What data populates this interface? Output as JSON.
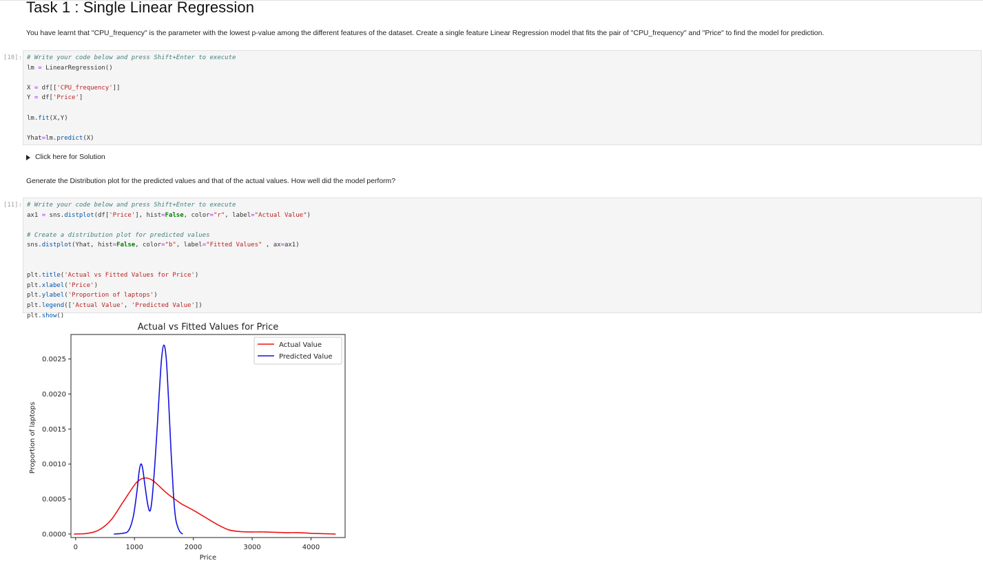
{
  "heading": "Task 1 : Single Linear Regression",
  "intro_text": "You have learnt that \"CPU_frequency\" is the parameter with the lowest p-value among the different features of the dataset. Create a single feature Linear Regression model that fits the pair of \"CPU_frequency\" and \"Price\" to find the model for prediction.",
  "cell1": {
    "prompt": "[10]:",
    "lines": [
      [
        [
          "cm",
          "# Write your code below and press Shift+Enter to execute"
        ]
      ],
      [
        [
          "",
          "lm "
        ],
        [
          "op",
          "="
        ],
        [
          "",
          " LinearRegression()"
        ]
      ],
      [],
      [
        [
          "",
          "X "
        ],
        [
          "op",
          "="
        ],
        [
          "",
          " df[["
        ],
        [
          "st",
          "'CPU_frequency'"
        ],
        [
          "",
          "]]"
        ]
      ],
      [
        [
          "",
          "Y "
        ],
        [
          "op",
          "="
        ],
        [
          "",
          " df["
        ],
        [
          "st",
          "'Price'"
        ],
        [
          "",
          "]"
        ]
      ],
      [],
      [
        [
          "",
          "lm."
        ],
        [
          "fn",
          "fit"
        ],
        [
          "",
          "(X,Y)"
        ]
      ],
      [],
      [
        [
          "",
          "Yhat"
        ],
        [
          "op",
          "="
        ],
        [
          "",
          "lm."
        ],
        [
          "fn",
          "predict"
        ],
        [
          "",
          "(X)"
        ]
      ]
    ]
  },
  "solution_toggle": "Click here for Solution",
  "question_text": "Generate the Distribution plot for the predicted values and that of the actual values. How well did the model perform?",
  "cell2": {
    "prompt": "[11]:",
    "lines": [
      [
        [
          "cm",
          "# Write your code below and press Shift+Enter to execute"
        ]
      ],
      [
        [
          "",
          "ax1 "
        ],
        [
          "op",
          "="
        ],
        [
          "",
          " sns."
        ],
        [
          "fn",
          "distplot"
        ],
        [
          "",
          "(df["
        ],
        [
          "st",
          "'Price'"
        ],
        [
          "",
          "], hist"
        ],
        [
          "op",
          "="
        ],
        [
          "kw",
          "False"
        ],
        [
          "",
          ", color"
        ],
        [
          "op",
          "="
        ],
        [
          "st",
          "\"r\""
        ],
        [
          "",
          ", label"
        ],
        [
          "op",
          "="
        ],
        [
          "st",
          "\"Actual Value\""
        ],
        [
          "",
          ")"
        ]
      ],
      [],
      [
        [
          "cm",
          "# Create a distribution plot for predicted values"
        ]
      ],
      [
        [
          "",
          "sns."
        ],
        [
          "fn",
          "distplot"
        ],
        [
          "",
          "(Yhat, hist"
        ],
        [
          "op",
          "="
        ],
        [
          "kw",
          "False"
        ],
        [
          "",
          ", color"
        ],
        [
          "op",
          "="
        ],
        [
          "st",
          "\"b\""
        ],
        [
          "",
          ", label"
        ],
        [
          "op",
          "="
        ],
        [
          "st",
          "\"Fitted Values\""
        ],
        [
          "",
          " , ax"
        ],
        [
          "op",
          "="
        ],
        [
          "",
          "ax1)"
        ]
      ],
      [],
      [],
      [
        [
          "",
          "plt."
        ],
        [
          "fn",
          "title"
        ],
        [
          "",
          "("
        ],
        [
          "st",
          "'Actual vs Fitted Values for Price'"
        ],
        [
          "",
          ")"
        ]
      ],
      [
        [
          "",
          "plt."
        ],
        [
          "fn",
          "xlabel"
        ],
        [
          "",
          "("
        ],
        [
          "st",
          "'Price'"
        ],
        [
          "",
          ")"
        ]
      ],
      [
        [
          "",
          "plt."
        ],
        [
          "fn",
          "ylabel"
        ],
        [
          "",
          "("
        ],
        [
          "st",
          "'Proportion of laptops'"
        ],
        [
          "",
          ")"
        ]
      ],
      [
        [
          "",
          "plt."
        ],
        [
          "fn",
          "legend"
        ],
        [
          "",
          "(["
        ],
        [
          "st",
          "'Actual Value'"
        ],
        [
          "",
          ", "
        ],
        [
          "st",
          "'Predicted Value'"
        ],
        [
          "",
          "])"
        ]
      ],
      [
        [
          "",
          "plt."
        ],
        [
          "fn",
          "show"
        ],
        [
          "",
          "()"
        ]
      ]
    ]
  },
  "chart_data": {
    "type": "line",
    "title": "Actual vs Fitted Values for Price",
    "xlabel": "Price",
    "ylabel": "Proportion of laptops",
    "xlim": [
      -80,
      4580
    ],
    "ylim": [
      -5e-05,
      0.00285
    ],
    "x_ticks": [
      0,
      1000,
      2000,
      3000,
      4000
    ],
    "x_tick_labels": [
      "0",
      "1000",
      "2000",
      "3000",
      "4000"
    ],
    "y_ticks": [
      0,
      0.0005,
      0.001,
      0.0015,
      0.002,
      0.0025
    ],
    "y_tick_labels": [
      "0.0000",
      "0.0005",
      "0.0010",
      "0.0015",
      "0.0020",
      "0.0025"
    ],
    "legend_position": "upper right",
    "series": [
      {
        "name": "Actual Value",
        "color": "#ee1111",
        "points": [
          [
            -30,
            0
          ],
          [
            200,
            1e-05
          ],
          [
            400,
            6e-05
          ],
          [
            600,
            0.0002
          ],
          [
            800,
            0.00045
          ],
          [
            1000,
            0.0007
          ],
          [
            1100,
            0.00078
          ],
          [
            1200,
            0.0008
          ],
          [
            1300,
            0.00077
          ],
          [
            1400,
            0.0007
          ],
          [
            1500,
            0.00062
          ],
          [
            1600,
            0.00055
          ],
          [
            1700,
            0.00049
          ],
          [
            1800,
            0.00043
          ],
          [
            2000,
            0.00034
          ],
          [
            2200,
            0.00024
          ],
          [
            2400,
            0.00014
          ],
          [
            2600,
            6e-05
          ],
          [
            2800,
            3.5e-05
          ],
          [
            3000,
            3e-05
          ],
          [
            3200,
            3e-05
          ],
          [
            3400,
            2.5e-05
          ],
          [
            3600,
            2e-05
          ],
          [
            3800,
            2e-05
          ],
          [
            4000,
            1e-05
          ],
          [
            4200,
            5e-06
          ],
          [
            4420,
            0
          ]
        ]
      },
      {
        "name": "Predicted Value",
        "color": "#1111dd",
        "points": [
          [
            650,
            0
          ],
          [
            800,
            1e-05
          ],
          [
            900,
            5e-05
          ],
          [
            980,
            0.00025
          ],
          [
            1040,
            0.0006
          ],
          [
            1080,
            0.0009
          ],
          [
            1110,
            0.001
          ],
          [
            1140,
            0.00093
          ],
          [
            1180,
            0.00068
          ],
          [
            1230,
            0.0004
          ],
          [
            1270,
            0.00034
          ],
          [
            1310,
            0.0006
          ],
          [
            1370,
            0.0013
          ],
          [
            1420,
            0.002
          ],
          [
            1460,
            0.0025
          ],
          [
            1500,
            0.0027
          ],
          [
            1540,
            0.0025
          ],
          [
            1580,
            0.0019
          ],
          [
            1620,
            0.0012
          ],
          [
            1660,
            0.0006
          ],
          [
            1700,
            0.00022
          ],
          [
            1760,
            5e-05
          ],
          [
            1820,
            0
          ]
        ]
      }
    ]
  }
}
